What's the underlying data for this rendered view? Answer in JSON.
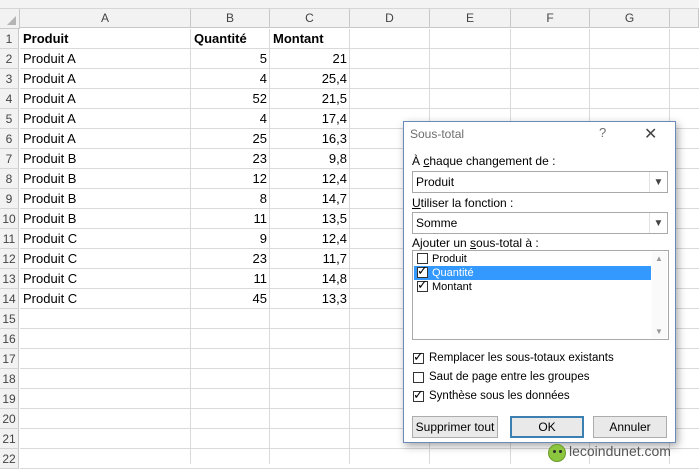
{
  "columns": [
    "A",
    "B",
    "C",
    "D",
    "E",
    "F",
    "G"
  ],
  "rows": [
    "1",
    "2",
    "3",
    "4",
    "5",
    "6",
    "7",
    "8",
    "9",
    "10",
    "11",
    "12",
    "13",
    "14",
    "15",
    "16",
    "17",
    "18",
    "19",
    "20",
    "21",
    "22"
  ],
  "header_row": [
    "Produit",
    "Quantité",
    "Montant"
  ],
  "data_rows": [
    [
      "Produit A",
      "5",
      "21"
    ],
    [
      "Produit A",
      "4",
      "25,4"
    ],
    [
      "Produit A",
      "52",
      "21,5"
    ],
    [
      "Produit A",
      "4",
      "17,4"
    ],
    [
      "Produit A",
      "25",
      "16,3"
    ],
    [
      "Produit B",
      "23",
      "9,8"
    ],
    [
      "Produit B",
      "12",
      "12,4"
    ],
    [
      "Produit B",
      "8",
      "14,7"
    ],
    [
      "Produit B",
      "11",
      "13,5"
    ],
    [
      "Produit C",
      "9",
      "12,4"
    ],
    [
      "Produit C",
      "23",
      "11,7"
    ],
    [
      "Produit C",
      "11",
      "14,8"
    ],
    [
      "Produit C",
      "45",
      "13,3"
    ]
  ],
  "dialog": {
    "title": "Sous-total",
    "help": "?",
    "close": "✕",
    "label_change_pre": "À ",
    "label_change_u": "c",
    "label_change_post": "haque changement de :",
    "change_value": "Produit",
    "label_func_pre": "",
    "label_func_u": "U",
    "label_func_post": "tiliser la fonction :",
    "func_value": "Somme",
    "label_add_pre": "Ajouter un ",
    "label_add_u": "s",
    "label_add_post": "ous-total à :",
    "list_items": [
      {
        "label": "Produit",
        "checked": false,
        "selected": false
      },
      {
        "label": "Quantité",
        "checked": true,
        "selected": true
      },
      {
        "label": "Montant",
        "checked": true,
        "selected": false
      }
    ],
    "opt_replace": "Remplacer les sous-totaux existants",
    "opt_replace_checked": true,
    "opt_pagebreak": "Saut de page entre les groupes",
    "opt_pagebreak_checked": false,
    "opt_summary": "Synthèse sous les données",
    "opt_summary_checked": true,
    "btn_remove": "Supprimer tout",
    "btn_ok": "OK",
    "btn_cancel": "Annuler"
  },
  "watermark": "lecoindunet.com",
  "colors": {
    "selection": "#3399ff",
    "dialog_border": "#6a8ab8",
    "ok_border": "#3c7fb1"
  }
}
